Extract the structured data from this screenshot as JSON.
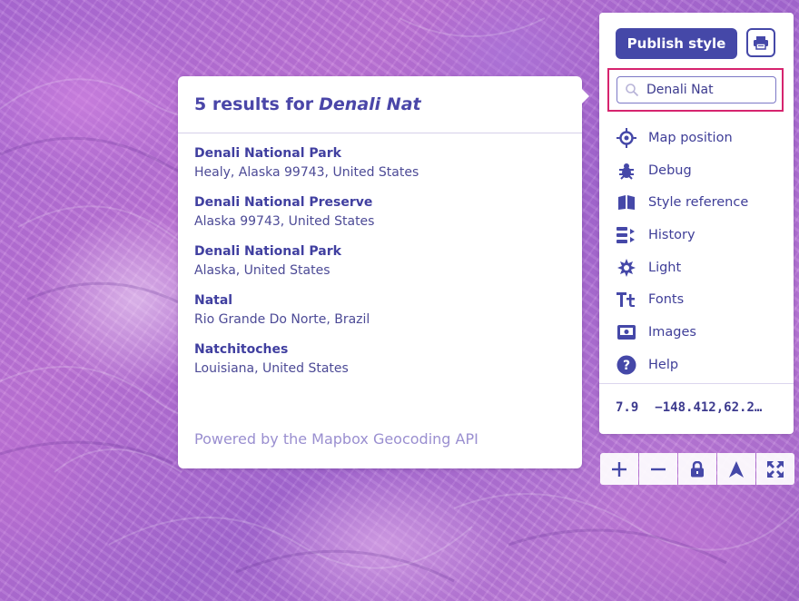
{
  "results": {
    "count_text": "5 results for",
    "query": "Denali Nat",
    "items": [
      {
        "name": "Denali National Park",
        "address": "Healy, Alaska 99743, United States"
      },
      {
        "name": "Denali National Preserve",
        "address": "Alaska 99743, United States"
      },
      {
        "name": "Denali National Park",
        "address": "Alaska, United States"
      },
      {
        "name": "Natal",
        "address": "Rio Grande Do Norte, Brazil"
      },
      {
        "name": "Natchitoches",
        "address": "Louisiana, United States"
      }
    ],
    "powered_by": "Powered by the Mapbox Geocoding API"
  },
  "toolbar": {
    "publish_label": "Publish style",
    "print_icon": "print-icon",
    "search": {
      "value": "Denali Nat",
      "icon": "search-icon",
      "highlight_color": "#d6246e"
    },
    "menu": [
      {
        "label": "Map position",
        "icon": "crosshair-icon"
      },
      {
        "label": "Debug",
        "icon": "bug-icon"
      },
      {
        "label": "Style reference",
        "icon": "book-icon"
      },
      {
        "label": "History",
        "icon": "history-icon"
      },
      {
        "label": "Light",
        "icon": "sun-icon"
      },
      {
        "label": "Fonts",
        "icon": "fonts-icon"
      },
      {
        "label": "Images",
        "icon": "image-icon"
      },
      {
        "label": "Help",
        "icon": "help-icon"
      }
    ],
    "zoom": "7.9",
    "coordinates": "−148.412,62.2…"
  },
  "map_controls": [
    {
      "icon": "zoom-in-icon"
    },
    {
      "icon": "zoom-out-icon"
    },
    {
      "icon": "lock-icon"
    },
    {
      "icon": "compass-icon"
    },
    {
      "icon": "fullscreen-icon"
    }
  ],
  "colors": {
    "accent": "#4548a8",
    "text": "#3f3e98",
    "map_base": "#b06fd6"
  }
}
